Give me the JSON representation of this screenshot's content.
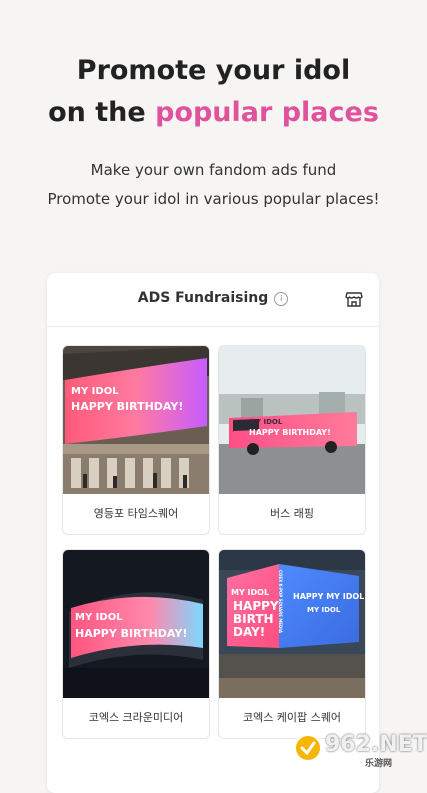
{
  "hero": {
    "title_line1": "Promote your idol",
    "title_line2_prefix": "on the ",
    "title_line2_accent": "popular places",
    "subtitle_line1": "Make your own fandom ads fund",
    "subtitle_line2": "Promote your idol in various popular places!"
  },
  "card": {
    "title": "ADS Fundraising",
    "info_icon": "info-icon",
    "store_icon": "store-icon"
  },
  "tiles": [
    {
      "label": "영등포 타임스퀘어",
      "bb_line1": "MY IDOL",
      "bb_line2": "HAPPY BIRTHDAY!"
    },
    {
      "label": "버스 래핑",
      "bb_line1": "MY IDOL",
      "bb_line2": "HAPPY BIRTHDAY!"
    },
    {
      "label": "코엑스 크라운미디어",
      "bb_line1": "MY IDOL",
      "bb_line2": "HAPPY BIRTHDAY!"
    },
    {
      "label": "코엑스 케이팝 스퀘어",
      "bb_line1": "MY IDOL",
      "bb_line2": "HAPPY",
      "bb_line3": "BIRTH",
      "bb_line4": "DAY!",
      "bb_side1": "HAPPY MY IDOL DAY!",
      "bb_side2": "MY IDOL",
      "bb_vertical": "COEX K-POP SQUARE MEDIA"
    }
  ],
  "watermark": {
    "main": "962.NET",
    "sub": "乐游网"
  },
  "colors": {
    "accent": "#e0529b",
    "background": "#f6f5f4"
  }
}
